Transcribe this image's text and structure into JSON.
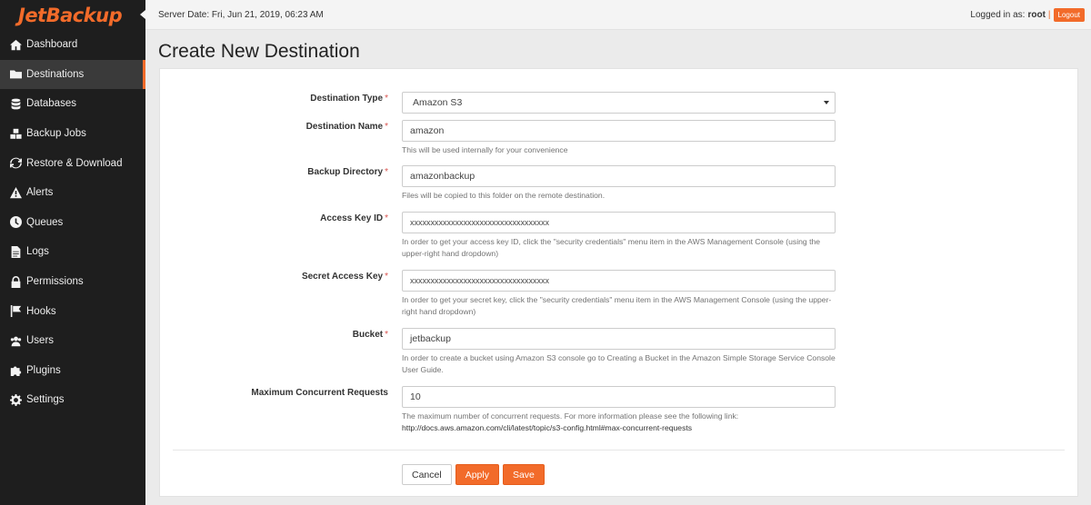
{
  "brand": {
    "logo_text": "JetBackup",
    "accent": "#f26b2a"
  },
  "topbar": {
    "server_date": "Server Date: Fri, Jun 21, 2019, 06:23 AM",
    "logged_in_label": "Logged in as:",
    "username": "root",
    "separator": "|",
    "logout_label": "Logout"
  },
  "sidebar": {
    "items": [
      {
        "label": "Dashboard",
        "icon": "home-icon"
      },
      {
        "label": "Destinations",
        "icon": "folder-icon",
        "active": true
      },
      {
        "label": "Databases",
        "icon": "database-icon"
      },
      {
        "label": "Backup Jobs",
        "icon": "cubes-icon"
      },
      {
        "label": "Restore & Download",
        "icon": "refresh-icon"
      },
      {
        "label": "Alerts",
        "icon": "warning-icon"
      },
      {
        "label": "Queues",
        "icon": "clock-icon"
      },
      {
        "label": "Logs",
        "icon": "file-icon"
      },
      {
        "label": "Permissions",
        "icon": "lock-icon"
      },
      {
        "label": "Hooks",
        "icon": "flag-icon"
      },
      {
        "label": "Users",
        "icon": "users-icon"
      },
      {
        "label": "Plugins",
        "icon": "puzzle-icon"
      },
      {
        "label": "Settings",
        "icon": "gear-icon"
      }
    ]
  },
  "page": {
    "title": "Create New Destination"
  },
  "form": {
    "destination_type": {
      "label": "Destination Type",
      "required": "*",
      "value": "Amazon S3"
    },
    "destination_name": {
      "label": "Destination Name",
      "required": "*",
      "value": "amazon",
      "help": "This will be used internally for your convenience"
    },
    "backup_directory": {
      "label": "Backup Directory",
      "required": "*",
      "value": "amazonbackup",
      "help": "Files will be copied to this folder on the remote destination."
    },
    "access_key_id": {
      "label": "Access Key ID",
      "required": "*",
      "value": "xxxxxxxxxxxxxxxxxxxxxxxxxxxxxxxxxx",
      "help": "In order to get your access key ID, click the \"security credentials\" menu item in the AWS Management Console (using the upper-right hand dropdown)"
    },
    "secret_access_key": {
      "label": "Secret Access Key",
      "required": "*",
      "value": "xxxxxxxxxxxxxxxxxxxxxxxxxxxxxxxxxx",
      "help": "In order to get your secret key, click the \"security credentials\" menu item in the AWS Management Console (using the upper-right hand dropdown)"
    },
    "bucket": {
      "label": "Bucket",
      "required": "*",
      "value": "jetbackup",
      "help": "In order to create a bucket using Amazon S3 console go to Creating a Bucket in the Amazon Simple Storage Service Console User Guide."
    },
    "max_concurrent_requests": {
      "label": "Maximum Concurrent Requests",
      "value": "10",
      "help": "The maximum number of concurrent requests. For more information please see the following link:",
      "link": "http://docs.aws.amazon.com/cli/latest/topic/s3-config.html#max-concurrent-requests"
    }
  },
  "actions": {
    "cancel": "Cancel",
    "apply": "Apply",
    "save": "Save"
  }
}
